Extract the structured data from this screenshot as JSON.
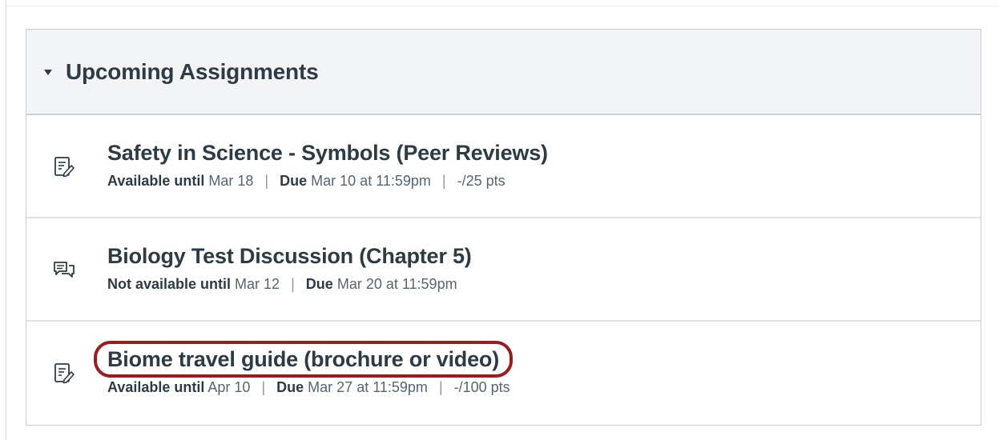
{
  "section": {
    "title": "Upcoming Assignments"
  },
  "items": [
    {
      "icon": "assignment-icon",
      "title": "Safety in Science - Symbols (Peer Reviews)",
      "availability_label": "Available until",
      "availability_date": "Mar 18",
      "due_label": "Due",
      "due_date": "Mar 10 at 11:59pm",
      "points": "-/25 pts"
    },
    {
      "icon": "discussion-icon",
      "title": "Biology Test Discussion (Chapter 5)",
      "availability_label": "Not available until",
      "availability_date": "Mar 12",
      "due_label": "Due",
      "due_date": "Mar 20 at 11:59pm"
    },
    {
      "icon": "assignment-icon",
      "title": "Biome travel guide (brochure or video)",
      "availability_label": "Available until",
      "availability_date": "Apr 10",
      "due_label": "Due",
      "due_date": "Mar 27 at 11:59pm",
      "points": "-/100 pts"
    }
  ],
  "colors": {
    "text": "#2d3b45",
    "header_bg": "#f3f4f5",
    "highlight": "#9e1b1d"
  }
}
